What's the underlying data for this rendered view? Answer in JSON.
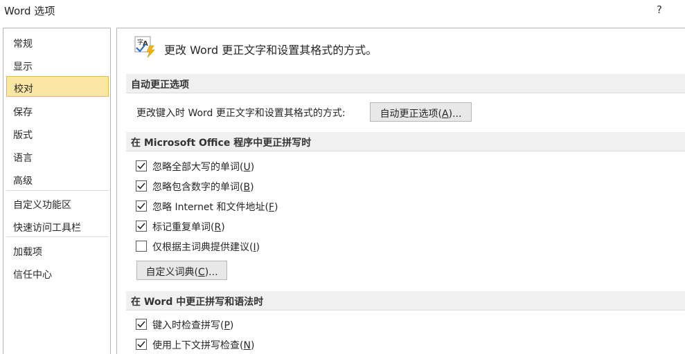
{
  "window": {
    "title": "Word 选项",
    "help": "?"
  },
  "nav": {
    "items": [
      {
        "label": "常规"
      },
      {
        "label": "显示"
      },
      {
        "label": "校对"
      },
      {
        "label": "保存"
      },
      {
        "label": "版式"
      },
      {
        "label": "语言"
      },
      {
        "label": "高级"
      },
      {
        "label": "自定义功能区"
      },
      {
        "label": "快速访问工具栏"
      },
      {
        "label": "加载项"
      },
      {
        "label": "信任中心"
      }
    ],
    "selected": "校对"
  },
  "header": {
    "icon": "proofing-abc-check-icon",
    "text": "更改 Word 更正文字和设置其格式的方式。"
  },
  "autocorrect": {
    "section_title": "自动更正选项",
    "description": "更改键入时 Word 更正文字和设置其格式的方式:",
    "button": {
      "text": "自动更正选项(",
      "key": "A",
      "tail": ")..."
    }
  },
  "office_spelling": {
    "section_title": "在 Microsoft Office 程序中更正拼写时",
    "options": [
      {
        "text": "忽略全部大写的单词(",
        "key": "U",
        "tail": ")",
        "checked": true
      },
      {
        "text": "忽略包含数字的单词(",
        "key": "B",
        "tail": ")",
        "checked": true
      },
      {
        "text": "忽略 Internet 和文件地址(",
        "key": "F",
        "tail": ")",
        "checked": true
      },
      {
        "text": "标记重复单词(",
        "key": "R",
        "tail": ")",
        "checked": true
      },
      {
        "text": "仅根据主词典提供建议(",
        "key": "I",
        "tail": ")",
        "checked": false
      }
    ],
    "button": {
      "text": "自定义词典(",
      "key": "C",
      "tail": ")..."
    }
  },
  "word_spelling": {
    "section_title": "在 Word 中更正拼写和语法时",
    "options": [
      {
        "text": "键入时检查拼写(",
        "key": "P",
        "tail": ")",
        "checked": true
      },
      {
        "text": "使用上下文拼写检查(",
        "key": "N",
        "tail": ")",
        "checked": true
      }
    ]
  },
  "colors": {
    "selected_bg": "#fbe6a6",
    "selected_border": "#e1bb54",
    "section_bg": "#f0f0f0"
  }
}
